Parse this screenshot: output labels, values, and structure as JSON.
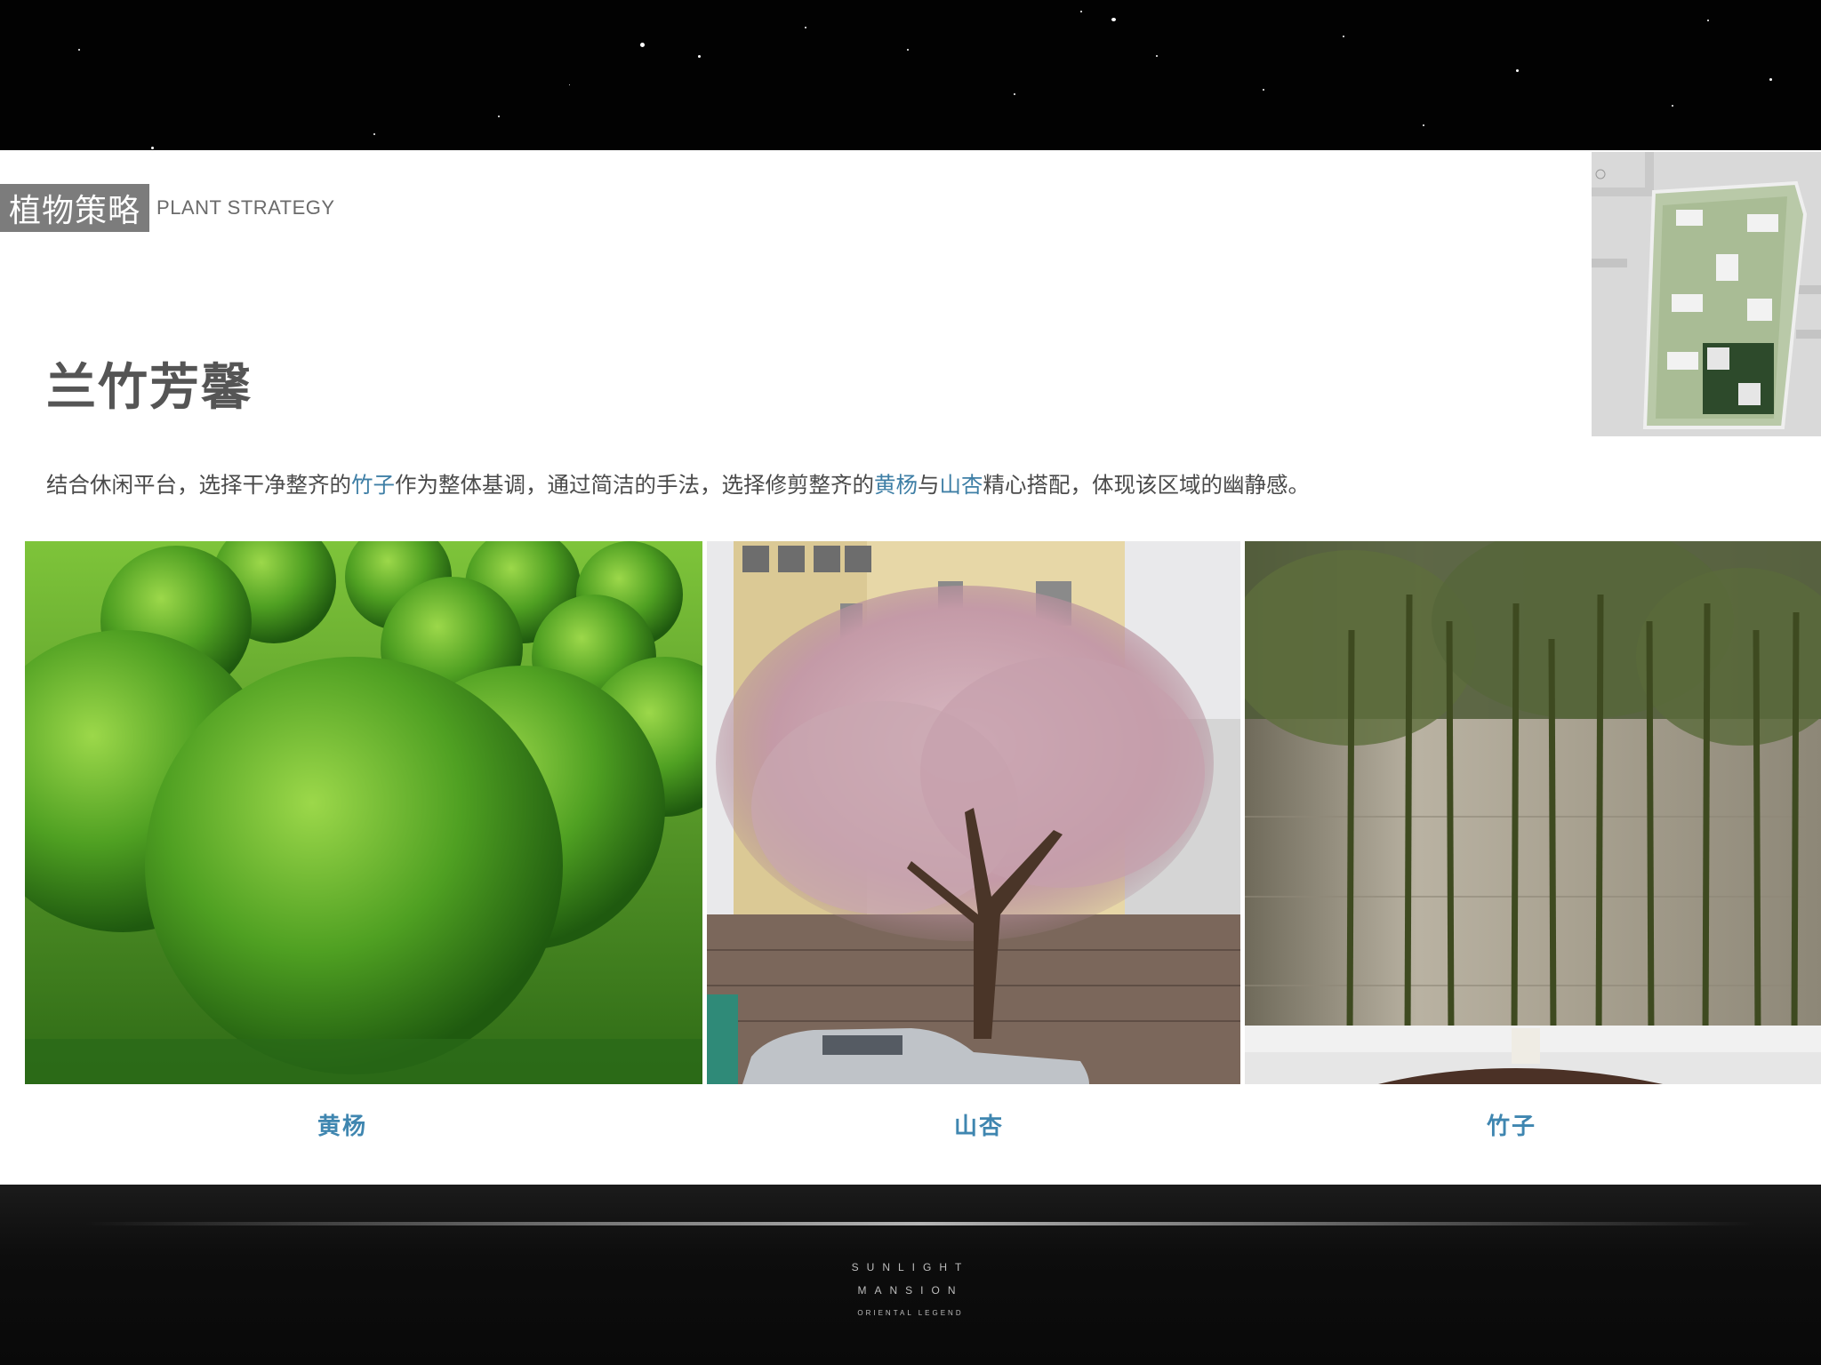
{
  "slide": {
    "section_label_cn": "植物策略",
    "section_label_en": "PLANT STRATEGY",
    "headline": "兰竹芳馨",
    "description_parts": {
      "p1": "结合休闲平台，选择干净整齐的",
      "plant_bamboo": "竹子",
      "p2": "作为整体基调，通过简洁的手法，选择修剪整齐的",
      "plant_boxwood": "黄杨",
      "p3": "与",
      "plant_apricot": "山杏",
      "p4": "精心搭配，体现该区域的幽静感。"
    },
    "highlight_color": "#3f7fa6",
    "photos": [
      {
        "caption": "黄杨",
        "icon": "boxwood-photo"
      },
      {
        "caption": "山杏",
        "icon": "apricot-photo"
      },
      {
        "caption": "竹子",
        "icon": "bamboo-photo"
      }
    ]
  },
  "footer": {
    "line1": "SUNLIGHT",
    "line2": "MANSION",
    "line3": "ORIENTAL LEGEND"
  }
}
